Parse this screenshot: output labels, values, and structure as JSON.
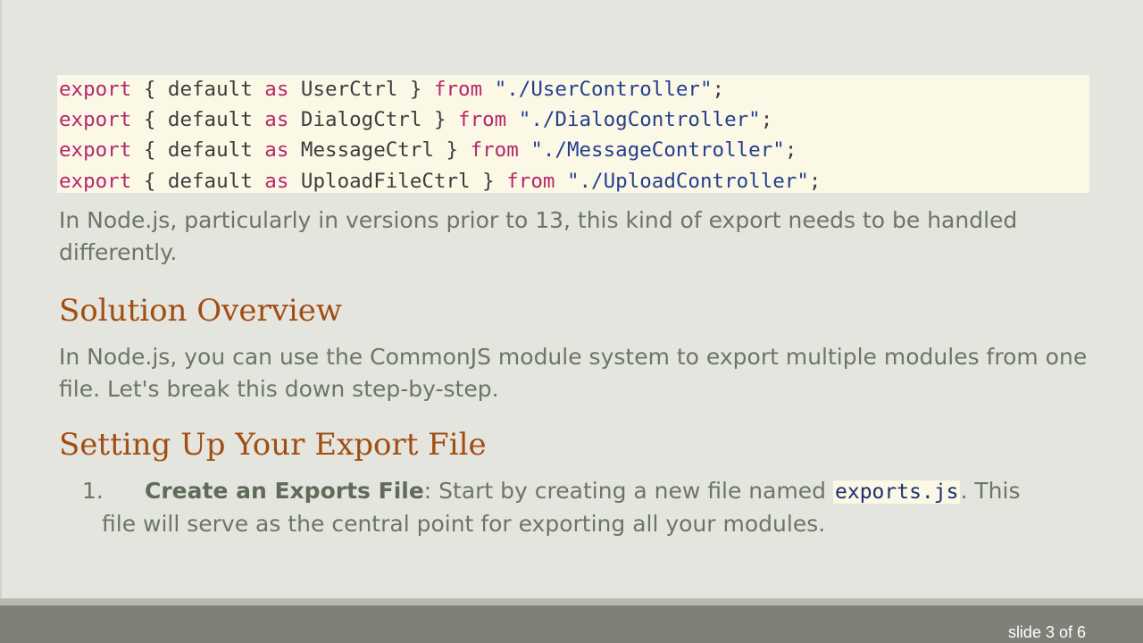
{
  "code": {
    "lines": [
      {
        "kw1": "export",
        "p1": " { default ",
        "kw2": "as",
        "p2": " UserCtrl } ",
        "kw3": "from",
        "p3": " ",
        "str": "\"./UserController\"",
        "end": ";"
      },
      {
        "kw1": "export",
        "p1": " { default ",
        "kw2": "as",
        "p2": " DialogCtrl } ",
        "kw3": "from",
        "p3": " ",
        "str": "\"./DialogController\"",
        "end": ";"
      },
      {
        "kw1": "export",
        "p1": " { default ",
        "kw2": "as",
        "p2": " MessageCtrl } ",
        "kw3": "from",
        "p3": " ",
        "str": "\"./MessageController\"",
        "end": ";"
      },
      {
        "kw1": "export",
        "p1": " { default ",
        "kw2": "as",
        "p2": " UploadFileCtrl } ",
        "kw3": "from",
        "p3": " ",
        "str": "\"./UploadController\"",
        "end": ";"
      }
    ]
  },
  "intro": {
    "text": "In Node.js, particularly in versions prior to 13, this kind of export needs to be handled differently."
  },
  "solution": {
    "heading": "Solution Overview",
    "text": "In Node.js, you can use the CommonJS module system to export multiple modules from one file. Let's break this down step-by-step."
  },
  "setup": {
    "heading": "Setting Up Your Export File",
    "items": [
      {
        "number": "1.",
        "bold": "Create an Exports File",
        "before_code": ": Start by creating a new file named ",
        "code": "exports.js",
        "after_code": ". This",
        "continuation": "file will serve as the central point for exporting all your modules."
      }
    ]
  },
  "footer": {
    "slide_indicator": "slide 3 of 6"
  },
  "colors": {
    "keyword": "#b5276b",
    "string": "#253f8f",
    "heading": "#a14e12",
    "body_text": "#6a7762",
    "code_background": "#fbf8e6",
    "footer": "#7f8179"
  }
}
